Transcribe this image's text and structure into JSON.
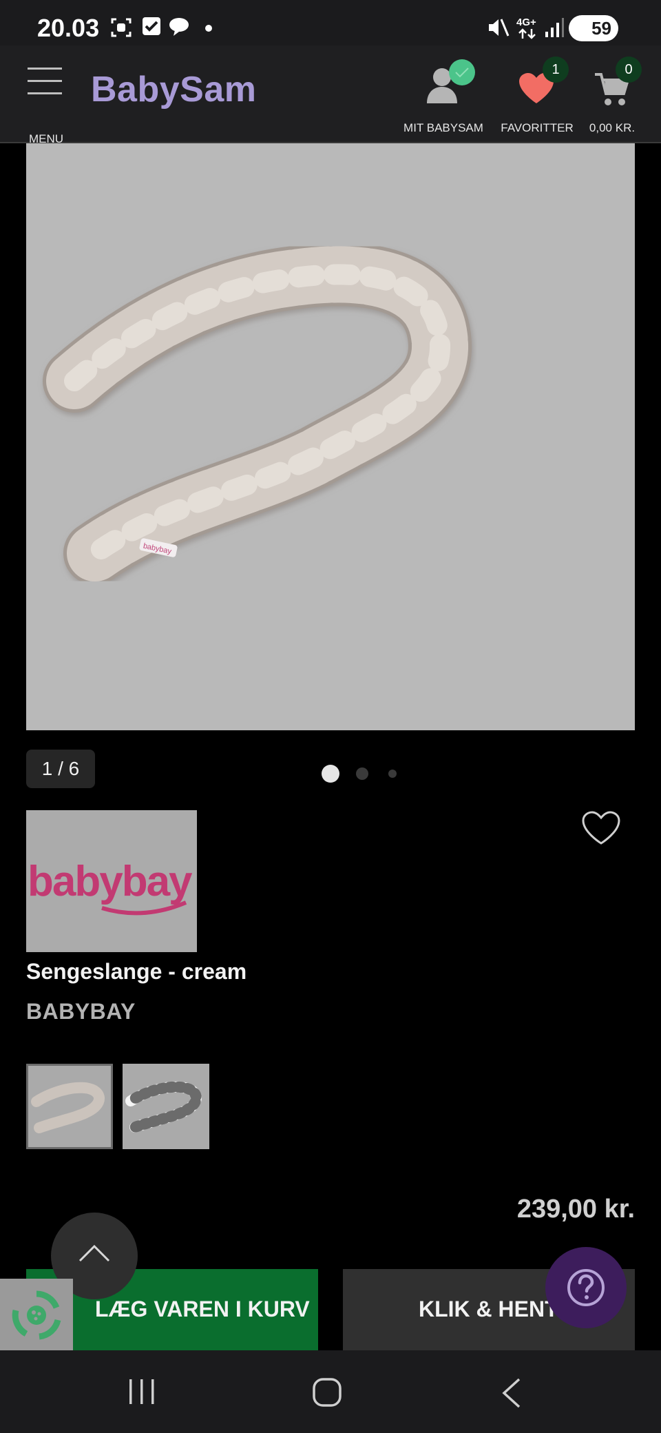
{
  "status_bar": {
    "time": "20.03",
    "network": "4G+",
    "battery": "59"
  },
  "header": {
    "menu_label": "MENU",
    "logo": "BabySam",
    "account_label": "MIT BABYSAM",
    "favorites_label": "FAVORITTER",
    "favorites_count": "1",
    "cart_label": "0,00 KR.",
    "cart_count": "0"
  },
  "gallery": {
    "counter": "1 / 6",
    "dots": 3,
    "active_dot": 1
  },
  "product": {
    "brand_logo_text": "babybay",
    "title": "Sengeslange - cream",
    "brand": "BABYBAY",
    "price": "239,00 kr."
  },
  "thumbnails": [
    {
      "color": "cream",
      "selected": true
    },
    {
      "color": "grey-white",
      "selected": false
    }
  ],
  "actions": {
    "add_to_cart": "LÆG VAREN I KURV",
    "click_collect": "KLIK & HENT"
  },
  "colors": {
    "accent_green": "#0a6e2e",
    "logo_purple": "#a89ad6",
    "favorite_red": "#f26d64",
    "badge_green": "#0f3d1f",
    "help_purple": "#3d1d5c"
  }
}
